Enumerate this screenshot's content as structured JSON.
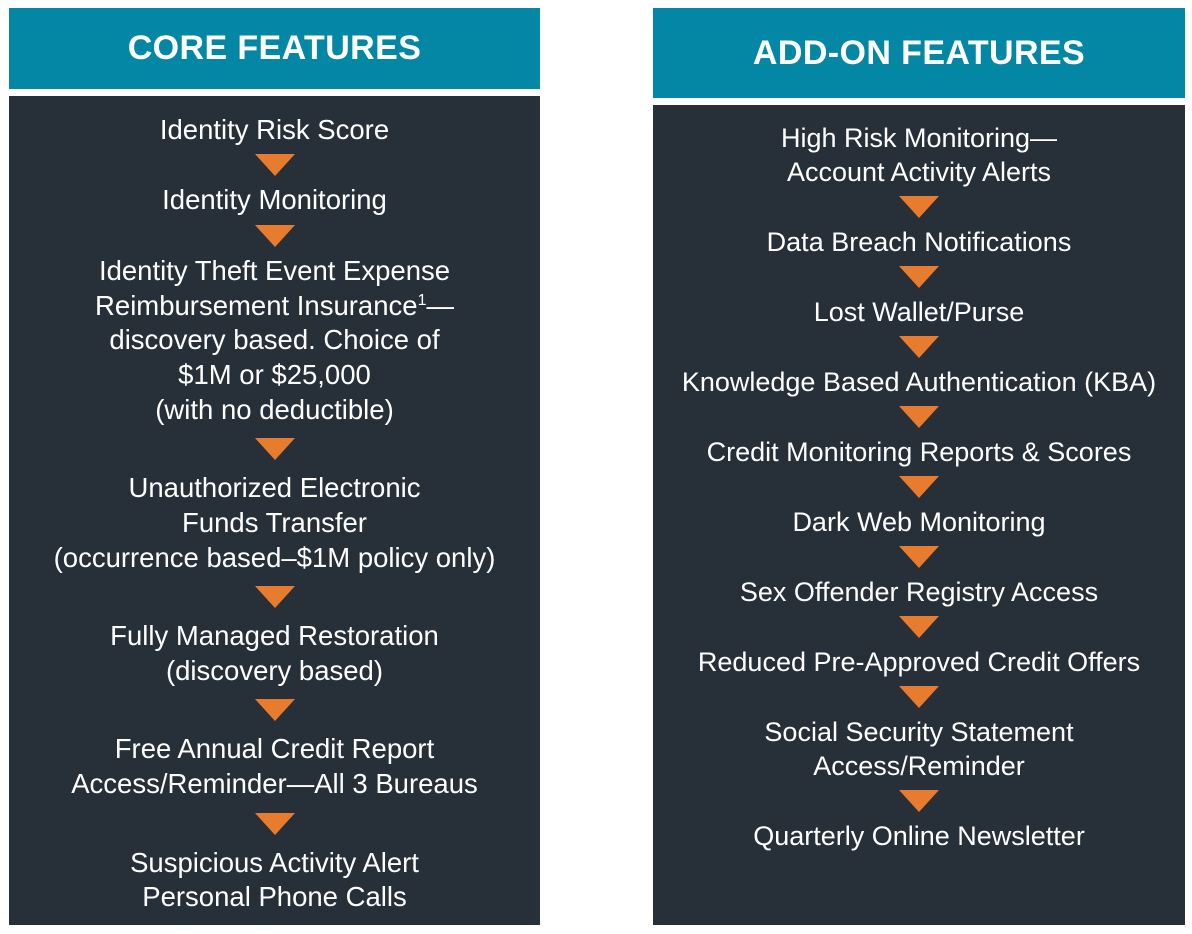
{
  "colors": {
    "header_teal": "#0487a4",
    "panel_dark": "#272f39",
    "arrow_orange": "#e87c2e",
    "text_white": "#ffffff",
    "page_background": "#ffffff"
  },
  "columns": [
    {
      "id": "core-features",
      "header": "CORE FEATURES",
      "items": [
        {
          "text": "Identity Risk Score"
        },
        {
          "text": "Identity Monitoring"
        },
        {
          "text_prefix": "Identity Theft Event Expense\nReimbursement Insurance",
          "superscript": "1",
          "text_suffix": "—\ndiscovery based. Choice of\n$1M or $25,000\n(with no deductible)"
        },
        {
          "text": "Unauthorized Electronic\nFunds Transfer\n(occurrence based–$1M policy only)"
        },
        {
          "text": "Fully Managed Restoration\n(discovery based)"
        },
        {
          "text": "Free Annual Credit Report\nAccess/Reminder—All 3 Bureaus"
        },
        {
          "text": "Suspicious Activity Alert\nPersonal Phone Calls"
        }
      ]
    },
    {
      "id": "add-on-features",
      "header": "ADD-ON FEATURES",
      "items": [
        {
          "text": "High Risk Monitoring—\nAccount Activity Alerts"
        },
        {
          "text": "Data Breach Notifications"
        },
        {
          "text": "Lost Wallet/Purse"
        },
        {
          "text": "Knowledge Based Authentication (KBA)"
        },
        {
          "text": "Credit Monitoring Reports & Scores"
        },
        {
          "text": "Dark Web Monitoring"
        },
        {
          "text": "Sex Offender Registry Access"
        },
        {
          "text": "Reduced Pre-Approved Credit Offers"
        },
        {
          "text": "Social Security Statement\nAccess/Reminder"
        },
        {
          "text": "Quarterly Online Newsletter"
        }
      ]
    }
  ],
  "icons": {
    "arrow": "down-arrow-icon"
  }
}
